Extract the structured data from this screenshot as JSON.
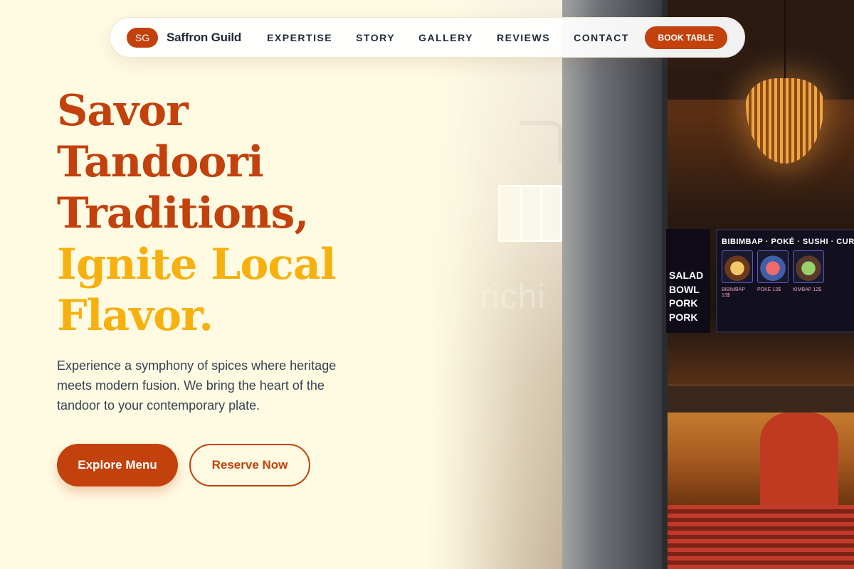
{
  "brand": {
    "initials": "SG",
    "name": "Saffron Guild"
  },
  "nav": {
    "links": [
      "EXPERTISE",
      "STORY",
      "GALLERY",
      "REVIEWS",
      "CONTACT"
    ],
    "cta": "BOOK TABLE"
  },
  "hero": {
    "title_lines": [
      "Savor",
      "Tandoori",
      "Traditions,"
    ],
    "highlight_lines": [
      "Ignite Local",
      "Flavor."
    ],
    "description": "Experience a symphony of spices where heritage meets modern fusion. We bring the heart of the tandoor to your contemporary plate.",
    "primary_button": "Explore Menu",
    "secondary_button": "Reserve Now"
  },
  "photo": {
    "menu_board_title": "BIBIMBAP · POKÉ · SUSHI · CURRY",
    "menu_captions": [
      "BIBIMBAP 13$",
      "POKE 13$",
      "KIMBAP 12$"
    ],
    "side_board_lines": [
      "SALAD",
      "BOWL",
      "PORK",
      "PORK"
    ],
    "watermark": "richi"
  },
  "colors": {
    "background": "#fffbe3",
    "brand": "#c2410c",
    "accent": "#f6b10e",
    "text": "#1f2937"
  }
}
